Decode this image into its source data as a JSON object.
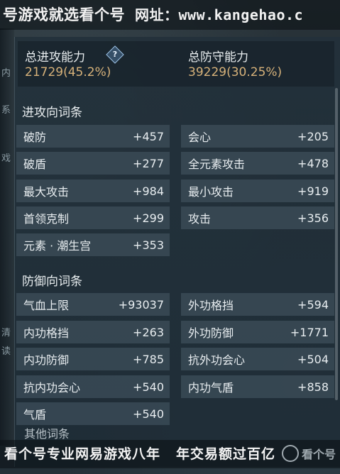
{
  "watermark": {
    "top_left": "号游戏就选看个号",
    "top_site": "网址：www.kangehao.c",
    "bottom_left": "看个号专业网易游戏八年",
    "bottom_right": "年交易额过百亿",
    "logo_text": "看个号"
  },
  "side_glyphs": [
    "内",
    "系",
    "戏",
    "清",
    "读"
  ],
  "summary": {
    "attack_label": "总进攻能力",
    "attack_value": "21729(45.2%)",
    "defense_label": "总防守能力",
    "defense_value": "39229(30.25%)",
    "help_icon": "?"
  },
  "attack_section": {
    "title": "进攻向词条",
    "rows": [
      [
        {
          "label": "破防",
          "value": "+457"
        },
        {
          "label": "会心",
          "value": "+205"
        }
      ],
      [
        {
          "label": "破盾",
          "value": "+277"
        },
        {
          "label": "全元素攻击",
          "value": "+478"
        }
      ],
      [
        {
          "label": "最大攻击",
          "value": "+984"
        },
        {
          "label": "最小攻击",
          "value": "+919"
        }
      ],
      [
        {
          "label": "首领克制",
          "value": "+299"
        },
        {
          "label": "攻击",
          "value": "+356"
        }
      ],
      [
        {
          "label": "元素 · 潮生宫",
          "value": "+353"
        }
      ]
    ]
  },
  "defense_section": {
    "title": "防御向词条",
    "rows": [
      [
        {
          "label": "气血上限",
          "value": "+93037"
        },
        {
          "label": "外功格挡",
          "value": "+594"
        }
      ],
      [
        {
          "label": "内功格挡",
          "value": "+263"
        },
        {
          "label": "外功防御",
          "value": "+1771"
        }
      ],
      [
        {
          "label": "内功防御",
          "value": "+785"
        },
        {
          "label": "抗外功会心",
          "value": "+504"
        }
      ],
      [
        {
          "label": "抗内功会心",
          "value": "+540"
        },
        {
          "label": "内功气盾",
          "value": "+858"
        }
      ],
      [
        {
          "label": "气盾",
          "value": "+540"
        }
      ]
    ]
  },
  "other_section": {
    "title": "其他词条"
  }
}
